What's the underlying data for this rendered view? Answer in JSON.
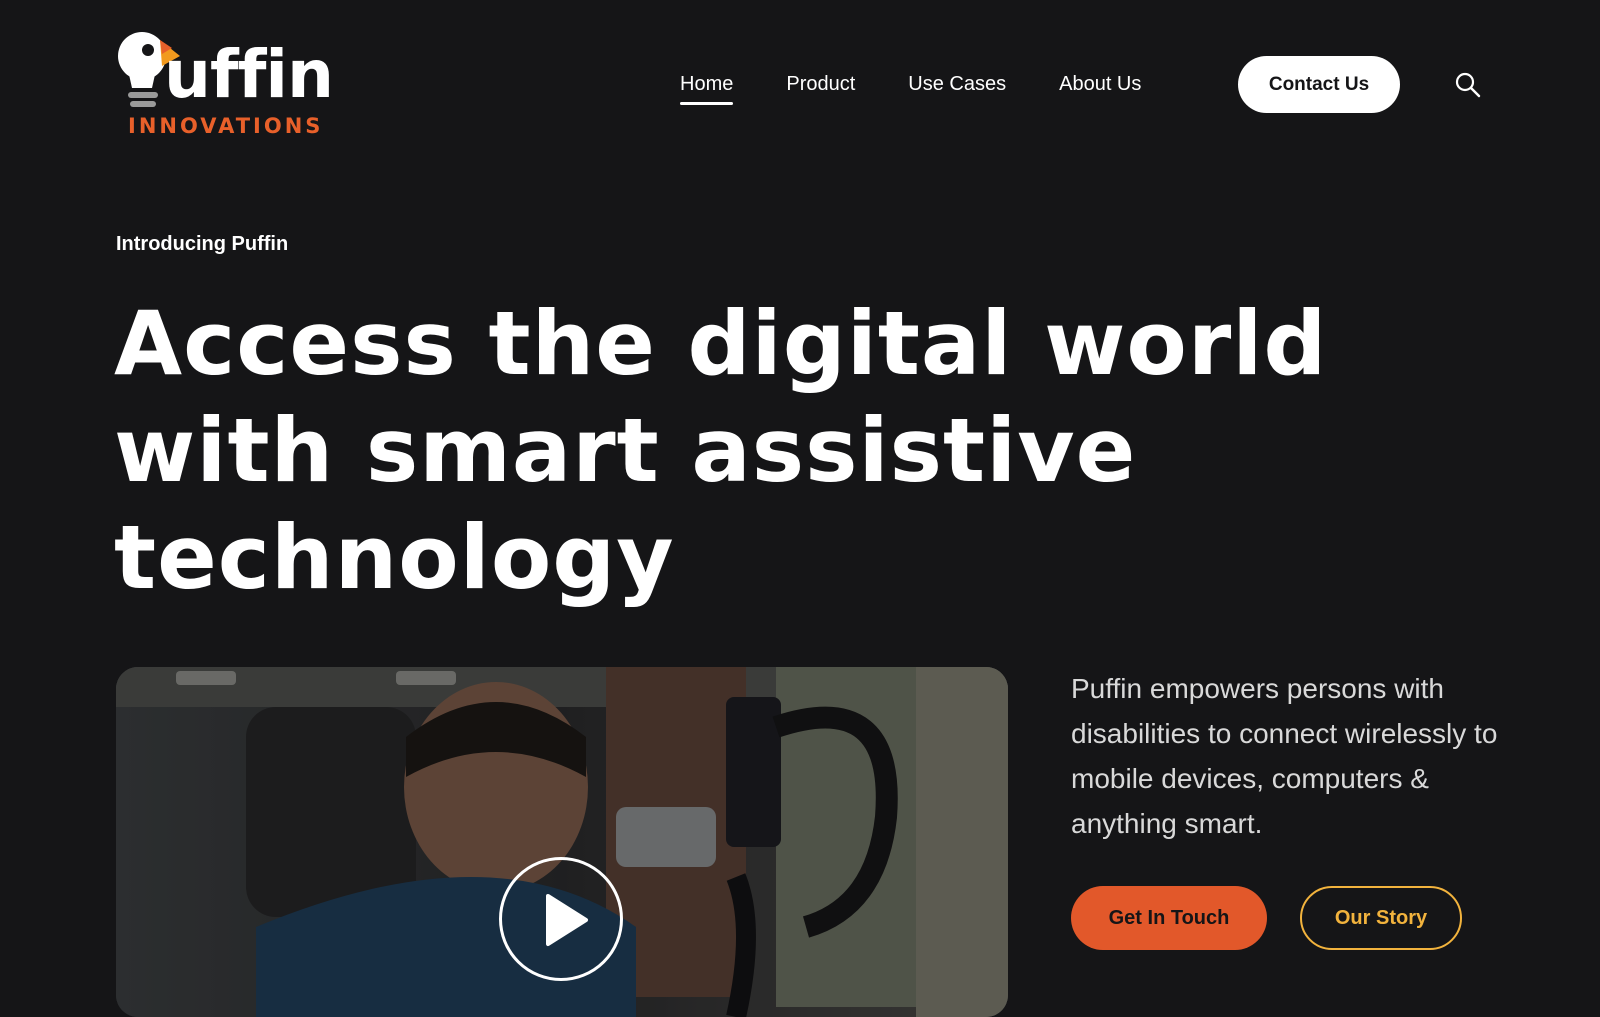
{
  "brand": {
    "logo_icon": "puffin-lightbulb-logo",
    "name": "uffin",
    "subtitle": "INNOVATIONS",
    "accent_color": "#e8602a"
  },
  "nav": {
    "items": [
      {
        "label": "Home",
        "active": true
      },
      {
        "label": "Product",
        "active": false
      },
      {
        "label": "Use Cases",
        "active": false
      },
      {
        "label": "About Us",
        "active": false
      }
    ],
    "contact_label": "Contact Us",
    "search_icon": "search-icon"
  },
  "hero": {
    "eyebrow": "Introducing Puffin",
    "headline": "Access the digital world with smart assistive technology"
  },
  "video": {
    "play_icon": "play-icon"
  },
  "intro": {
    "text": "Puffin empowers persons with disabilities to connect wirelessly to mobile devices, computers & anything smart."
  },
  "cta": {
    "primary_label": "Get In Touch",
    "secondary_label": "Our Story",
    "primary_color": "#e2582a",
    "secondary_color": "#f2b33d"
  }
}
